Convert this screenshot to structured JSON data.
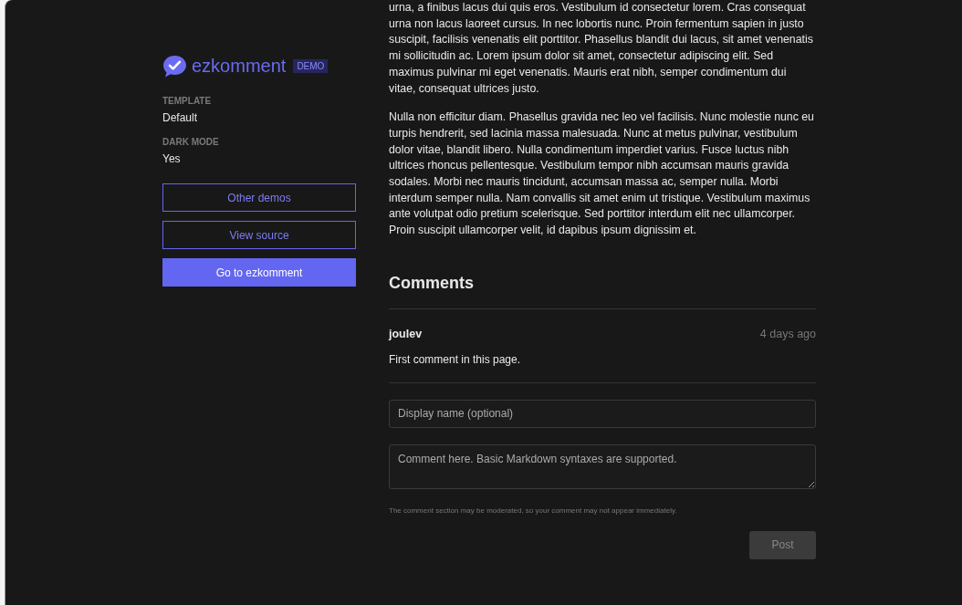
{
  "sidebar": {
    "logo": {
      "name": "ezkomment",
      "badge": "DEMO"
    },
    "settings": [
      {
        "label": "TEMPLATE",
        "value": "Default"
      },
      {
        "label": "DARK MODE",
        "value": "Yes"
      }
    ],
    "buttons": [
      {
        "label": "Other demos",
        "kind": "outline"
      },
      {
        "label": "View source",
        "kind": "outline"
      },
      {
        "label": "Go to ezkomment",
        "kind": "primary"
      }
    ]
  },
  "article": {
    "paragraphs": [
      "urna, a finibus lacus dui quis eros. Vestibulum id consectetur lorem. Cras consequat urna non lacus laoreet cursus. In nec lobortis nunc. Proin fermentum sapien in justo suscipit, facilisis venenatis elit porttitor. Phasellus blandit dui lacus, sit amet venenatis mi sollicitudin ac. Lorem ipsum dolor sit amet, consectetur adipiscing elit. Sed maximus pulvinar mi eget venenatis. Mauris erat nibh, semper condimentum dui vitae, consequat ultrices justo.",
      "Nulla non efficitur diam. Phasellus gravida nec leo vel facilisis. Nunc molestie nunc eu turpis hendrerit, sed lacinia massa malesuada. Nunc at metus pulvinar, vestibulum dolor vitae, blandit libero. Nulla condimentum imperdiet varius. Fusce luctus nibh ultrices rhoncus pellentesque. Vestibulum tempor nibh accumsan mauris gravida sodales. Morbi nec mauris tincidunt, accumsan massa ac, semper nulla. Morbi interdum semper nulla. Nam convallis sit amet enim ut tristique. Vestibulum maximus ante volutpat odio pretium scelerisque. Sed porttitor interdum elit nec ullamcorper. Proin suscipit ullamcorper velit, id dapibus ipsum dignissim et."
    ]
  },
  "comments": {
    "title": "Comments",
    "items": [
      {
        "author": "joulev",
        "time": "4 days ago",
        "text": "First comment in this page."
      }
    ],
    "form": {
      "name_placeholder": "Display name (optional)",
      "comment_placeholder": "Comment here. Basic Markdown syntaxes are supported.",
      "note": "The comment section may be moderated, so your comment may not appear immediately.",
      "submit": {
        "label": "Post",
        "disabled": true
      }
    }
  }
}
